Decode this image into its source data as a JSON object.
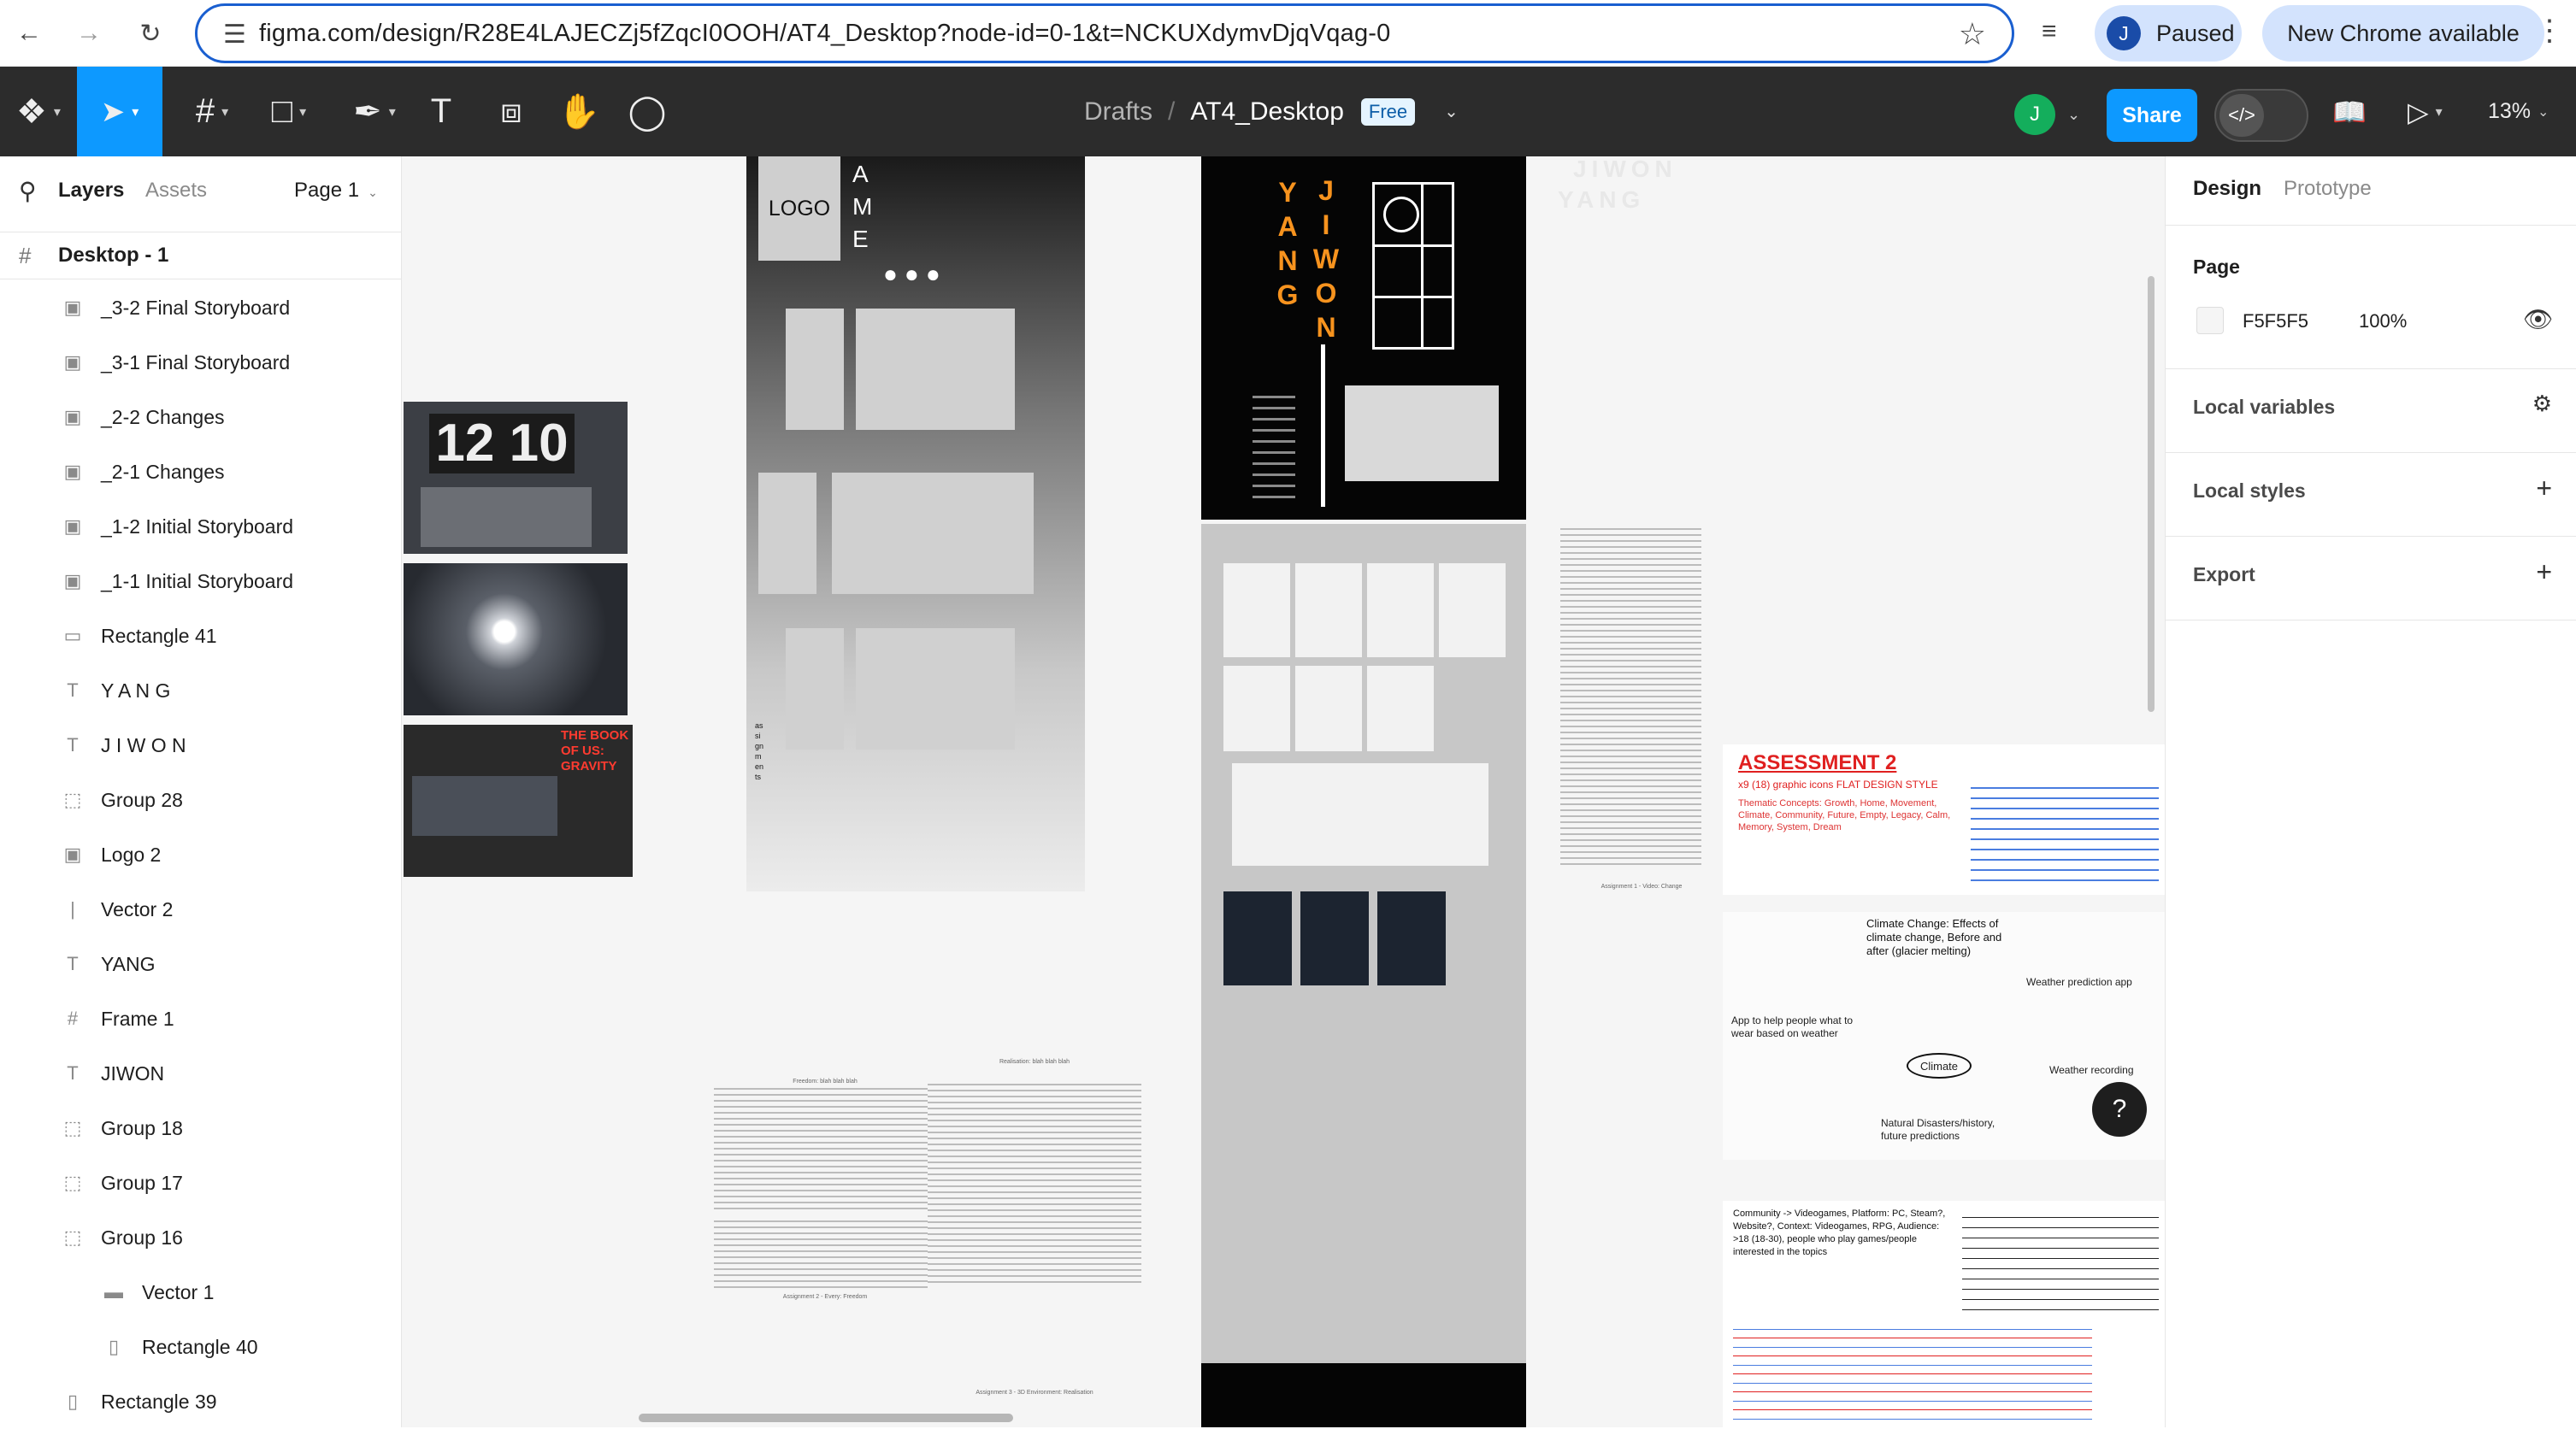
{
  "browser": {
    "url": "figma.com/design/R28E4LAJECZj5fZqcI0OOH/AT4_Desktop?node-id=0-1&t=NCKUXdymvDjqVqag-0",
    "profile_initial": "J",
    "profile_status": "Paused",
    "update_notice": "New Chrome available",
    "icons": {
      "back": "back-arrow-icon",
      "forward": "forward-arrow-icon",
      "reload": "reload-icon",
      "site_info": "tune-icon",
      "bookmark": "star-icon",
      "media": "media-queue-icon",
      "menu": "more-vert-icon"
    }
  },
  "toolbar": {
    "breadcrumb_root": "Drafts",
    "breadcrumb_sep": "/",
    "file_name": "AT4_Desktop",
    "plan_badge": "Free",
    "user_initial": "J",
    "share_label": "Share",
    "zoom": "13%",
    "accent_color": "#0d99ff"
  },
  "layers_panel": {
    "tab_layers": "Layers",
    "tab_assets": "Assets",
    "page_selector": "Page 1",
    "frame_name": "Desktop - 1",
    "items": [
      {
        "label": "_3-2 Final Storyboard",
        "icon": "image-icon"
      },
      {
        "label": "_3-1 Final Storyboard",
        "icon": "image-icon"
      },
      {
        "label": "_2-2 Changes",
        "icon": "image-icon"
      },
      {
        "label": "_2-1 Changes",
        "icon": "image-icon"
      },
      {
        "label": "_1-2 Initial Storyboard",
        "icon": "image-icon"
      },
      {
        "label": "_1-1 Initial Storyboard",
        "icon": "image-icon"
      },
      {
        "label": "Rectangle 41",
        "icon": "rectangle-icon"
      },
      {
        "label": "Y A N G",
        "icon": "text-icon"
      },
      {
        "label": "J I W O N",
        "icon": "text-icon"
      },
      {
        "label": "Group 28",
        "icon": "group-icon"
      },
      {
        "label": "Logo 2",
        "icon": "image-icon"
      },
      {
        "label": "Vector 2",
        "icon": "vector-line-icon"
      },
      {
        "label": "YANG",
        "icon": "text-icon"
      },
      {
        "label": "Frame 1",
        "icon": "frame-icon"
      },
      {
        "label": "JIWON",
        "icon": "text-icon"
      },
      {
        "label": "Group 18",
        "icon": "group-icon"
      },
      {
        "label": "Group 17",
        "icon": "group-icon"
      },
      {
        "label": "Group 16",
        "icon": "group-icon"
      },
      {
        "label": "Vector 1",
        "icon": "vector-icon"
      },
      {
        "label": "Rectangle 40",
        "icon": "rectangle-icon"
      },
      {
        "label": "Rectangle 39",
        "icon": "rectangle-icon"
      }
    ]
  },
  "canvas": {
    "background": "#f5f5f5",
    "photo_clock_text": "12 10",
    "photo_laptop_text": "THE BOOK OF US: GRAVITY",
    "poster_logo": "LOGO",
    "poster_name_letters": "A M E",
    "poster_side_text": "assignments",
    "jiwon_letters": "J I W O N",
    "yang_letters": "Y A N G",
    "faded_name_1": "JIWON",
    "faded_name_2": "YANG",
    "accent_orange": "#f7931e",
    "assessment_title": "ASSESSMENT 2",
    "assessment_subtitle": "x9 (18) graphic icons FLAT DESIGN STYLE",
    "assessment_concepts": "Thematic Concepts: Growth, Home, Movement, Climate, Community, Future, Empty, Legacy, Calm, Memory, System, Dream",
    "mindmap_center": "Climate",
    "mindmap_top": "Climate Change: Effects of climate change, Before and after (glacier melting)",
    "mindmap_right1": "Weather prediction app",
    "mindmap_right2": "Weather recording",
    "mindmap_left": "App to help people what to wear based on weather",
    "mindmap_bottom": "Natural Disasters/history, future predictions",
    "community_note": "Community -> Videogames, Platform: PC, Steam?, Website?, Context: Videogames, RPG, Audience: >18 (18-30), people who play games/people interested in the topics",
    "essay_title_1": "Freedom: blah blah blah",
    "essay_title_2": "Realisation: blah blah blah",
    "essay_caption_1": "Assignment 2 - Every: Freedom",
    "essay_caption_2": "Assignment 3 - 3D Environment: Realisation",
    "change_caption": "Assignment 1 - Video: Change"
  },
  "design_panel": {
    "tab_design": "Design",
    "tab_prototype": "Prototype",
    "page_section": "Page",
    "page_color": "F5F5F5",
    "page_opacity": "100%",
    "local_variables": "Local variables",
    "local_styles": "Local styles",
    "export": "Export"
  }
}
